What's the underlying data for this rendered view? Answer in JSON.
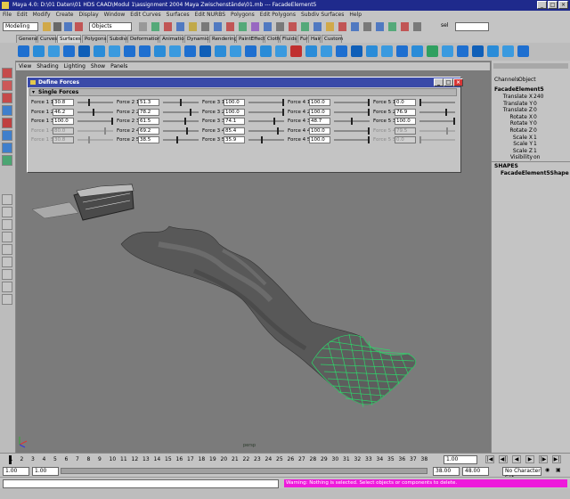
{
  "window": {
    "title": "Maya 4.0: D:\\01 Daten\\01 HDS CAAD\\Modul 1\\assignment 2004 Maya Zwischenstände\\01.mb   ---   FacadeElement5"
  },
  "menus": [
    "File",
    "Edit",
    "Modify",
    "Create",
    "Display",
    "Window",
    "Edit Curves",
    "Surfaces",
    "Edit NURBS",
    "Polygons",
    "Edit Polygons",
    "Subdiv Surfaces",
    "Help"
  ],
  "status_line": {
    "mode": "Modeling",
    "select_by": "Objects",
    "sel_label": "sel"
  },
  "shelf_tabs": [
    "General",
    "Curves",
    "Surfaces",
    "Polygons",
    "Subdivs",
    "Deformation",
    "Animation",
    "Dynamics",
    "Rendering",
    "PaintEffects",
    "Cloth",
    "Fluids",
    "Fur",
    "Hair",
    "Custom"
  ],
  "shelf_active": "Surfaces",
  "panel_menu": [
    "View",
    "Shading",
    "Lighting",
    "Show",
    "Panels"
  ],
  "viewport": {
    "camera_label": "persp"
  },
  "dialog": {
    "title": "Define Forces",
    "section": "Single Forces",
    "columns": [
      {
        "forces": [
          {
            "label": "Force 1 1",
            "value": "30.8",
            "level": 0.31,
            "enabled": true
          },
          {
            "label": "Force 1 2",
            "value": "46.2",
            "level": 0.46,
            "enabled": true
          },
          {
            "label": "Force 1 3",
            "value": "100.0",
            "level": 1.0,
            "enabled": true
          },
          {
            "label": "Force 1 4",
            "value": "80.0",
            "level": 0.8,
            "enabled": false
          },
          {
            "label": "Force 1 5",
            "value": "30.8",
            "level": 0.31,
            "enabled": false
          }
        ]
      },
      {
        "forces": [
          {
            "label": "Force 2 1",
            "value": "51.3",
            "level": 0.51,
            "enabled": true
          },
          {
            "label": "Force 2 2",
            "value": "78.2",
            "level": 0.78,
            "enabled": true
          },
          {
            "label": "Force 2 3",
            "value": "61.5",
            "level": 0.62,
            "enabled": true
          },
          {
            "label": "Force 2 4",
            "value": "69.2",
            "level": 0.69,
            "enabled": true
          },
          {
            "label": "Force 2 5",
            "value": "38.5",
            "level": 0.39,
            "enabled": true
          }
        ]
      },
      {
        "forces": [
          {
            "label": "Force 3 1",
            "value": "100.0",
            "level": 1.0,
            "enabled": true
          },
          {
            "label": "Force 3 2",
            "value": "100.0",
            "level": 1.0,
            "enabled": true
          },
          {
            "label": "Force 3 3",
            "value": "74.1",
            "level": 0.74,
            "enabled": true
          },
          {
            "label": "Force 3 4",
            "value": "85.4",
            "level": 0.85,
            "enabled": true
          },
          {
            "label": "Force 3 5",
            "value": "35.9",
            "level": 0.36,
            "enabled": true
          }
        ]
      },
      {
        "forces": [
          {
            "label": "Force 4 1",
            "value": "100.0",
            "level": 1.0,
            "enabled": true
          },
          {
            "label": "Force 4 2",
            "value": "100.0",
            "level": 1.0,
            "enabled": true
          },
          {
            "label": "Force 4 3",
            "value": "48.7",
            "level": 0.49,
            "enabled": true
          },
          {
            "label": "Force 4 4",
            "value": "100.0",
            "level": 1.0,
            "enabled": true
          },
          {
            "label": "Force 4 5",
            "value": "100.0",
            "level": 1.0,
            "enabled": true
          }
        ]
      },
      {
        "forces": [
          {
            "label": "Force 5 1",
            "value": "0.0",
            "level": 0.0,
            "enabled": true
          },
          {
            "label": "Force 5 2",
            "value": "76.9",
            "level": 0.77,
            "enabled": true
          },
          {
            "label": "Force 5 3",
            "value": "100.0",
            "level": 1.0,
            "enabled": true
          },
          {
            "label": "Force 5 4",
            "value": "79.5",
            "level": 0.8,
            "enabled": false
          },
          {
            "label": "Force 5 5",
            "value": "0.0",
            "level": 0.0,
            "enabled": false
          }
        ]
      }
    ]
  },
  "channel_box": {
    "tabs": [
      "Channels",
      "Object"
    ],
    "object_name": "FacadeElement5",
    "channels": [
      {
        "name": "Translate X",
        "value": "240"
      },
      {
        "name": "Translate Y",
        "value": "0"
      },
      {
        "name": "Translate Z",
        "value": "0"
      },
      {
        "name": "Rotate X",
        "value": "0"
      },
      {
        "name": "Rotate Y",
        "value": "0"
      },
      {
        "name": "Rotate Z",
        "value": "0"
      },
      {
        "name": "Scale X",
        "value": "1"
      },
      {
        "name": "Scale Y",
        "value": "1"
      },
      {
        "name": "Scale Z",
        "value": "1"
      },
      {
        "name": "Visibility",
        "value": "on"
      }
    ],
    "shapes_header": "SHAPES",
    "shape_name": "FacadeElement5Shape"
  },
  "timeline": {
    "ticks": [
      "1",
      "2",
      "3",
      "4",
      "5",
      "6",
      "7",
      "8",
      "9",
      "10",
      "11",
      "12",
      "13",
      "14",
      "15",
      "16",
      "17",
      "18",
      "19",
      "20",
      "21",
      "22",
      "23",
      "24",
      "25",
      "26",
      "27",
      "28",
      "29",
      "30",
      "31",
      "32",
      "33",
      "34",
      "35",
      "36",
      "37",
      "38"
    ],
    "current_frame": "1.00"
  },
  "range": {
    "start": "1.00",
    "playback_start": "1.00",
    "playback_end": "38.00",
    "end": "48.00",
    "character_set": "No Character Set"
  },
  "feedback": "Warning: Nothing is selected. Select objects or components to delete."
}
